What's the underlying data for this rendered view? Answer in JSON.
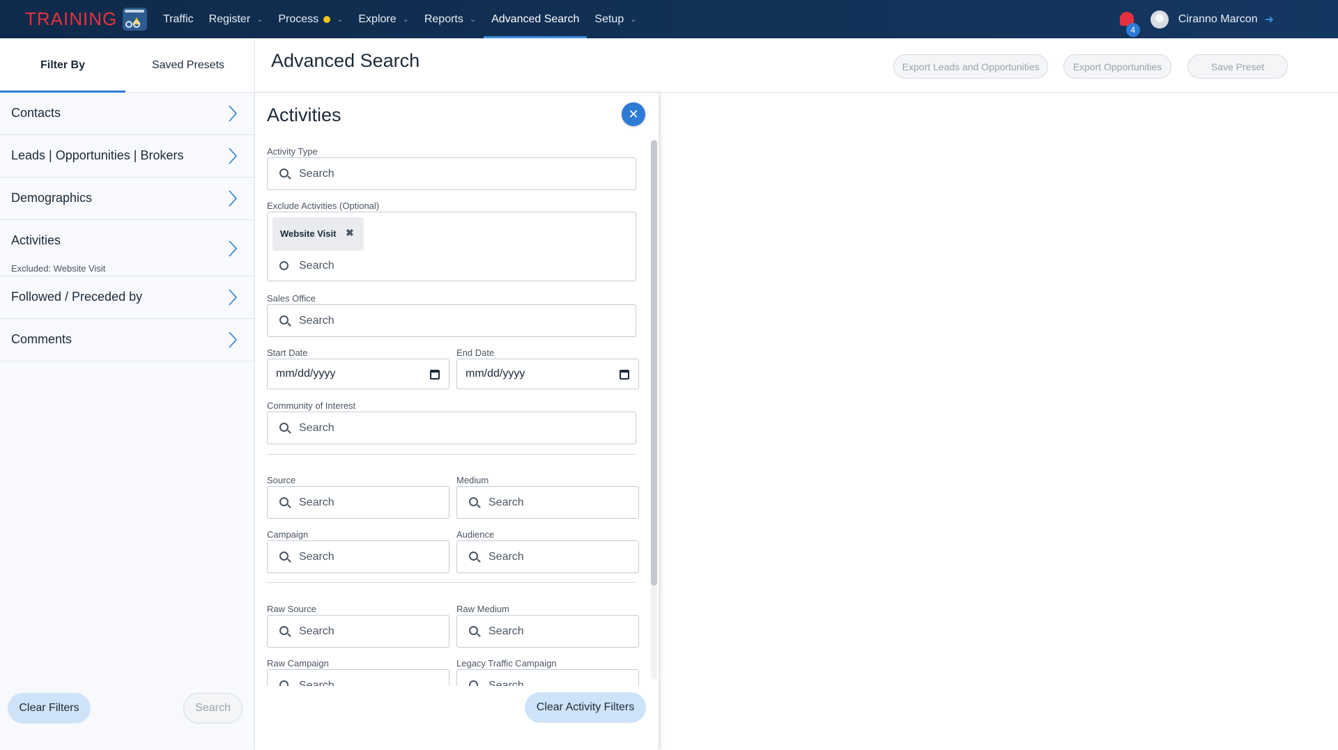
{
  "brand": "TRAINING",
  "nav": {
    "items": [
      {
        "label": "Traffic"
      },
      {
        "label": "Register"
      },
      {
        "label": "Process"
      },
      {
        "label": "Explore"
      },
      {
        "label": "Reports"
      },
      {
        "label": "Advanced Search"
      },
      {
        "label": "Setup"
      }
    ],
    "active": "Advanced Search",
    "notification_count": "4",
    "username": "Ciranno Marcon",
    "logout_icon": "logout-icon"
  },
  "left": {
    "tabs": [
      {
        "label": "Filter By"
      },
      {
        "label": "Saved Presets"
      }
    ],
    "filters": [
      {
        "label": "Contacts"
      },
      {
        "label": "Leads | Opportunities | Brokers"
      },
      {
        "label": "Demographics"
      },
      {
        "label": "Activities",
        "sub": "Excluded: Website Visit"
      },
      {
        "label": "Followed / Preceded by"
      },
      {
        "label": "Comments"
      }
    ],
    "clear_label": "Clear Filters",
    "search_label": "Search"
  },
  "main": {
    "title": "Advanced Search",
    "export_leads_label": "Export Leads and Opportunities",
    "export_opps_label": "Export Opportunities",
    "save_preset_label": "Save Preset"
  },
  "activities": {
    "title": "Activities",
    "activity_type_label": "Activity Type",
    "exclude_label": "Exclude Activities (Optional)",
    "excluded_chip": "Website Visit",
    "sales_office_label": "Sales Office",
    "start_date_label": "Start Date",
    "end_date_label": "End Date",
    "date_placeholder": "mm/dd/yyyy",
    "community_label": "Community of Interest",
    "source_label": "Source",
    "medium_label": "Medium",
    "campaign_label": "Campaign",
    "audience_label": "Audience",
    "raw_source_label": "Raw Source",
    "raw_medium_label": "Raw Medium",
    "raw_campaign_label": "Raw Campaign",
    "legacy_campaign_label": "Legacy Traffic Campaign",
    "search_placeholder": "Search",
    "clear_label": "Clear Activity Filters"
  },
  "colors": {
    "nav_bg": "#0f2a4a",
    "brand": "#e5323e",
    "accent": "#2d7bd4",
    "pill_bg": "#cfe3f8"
  }
}
